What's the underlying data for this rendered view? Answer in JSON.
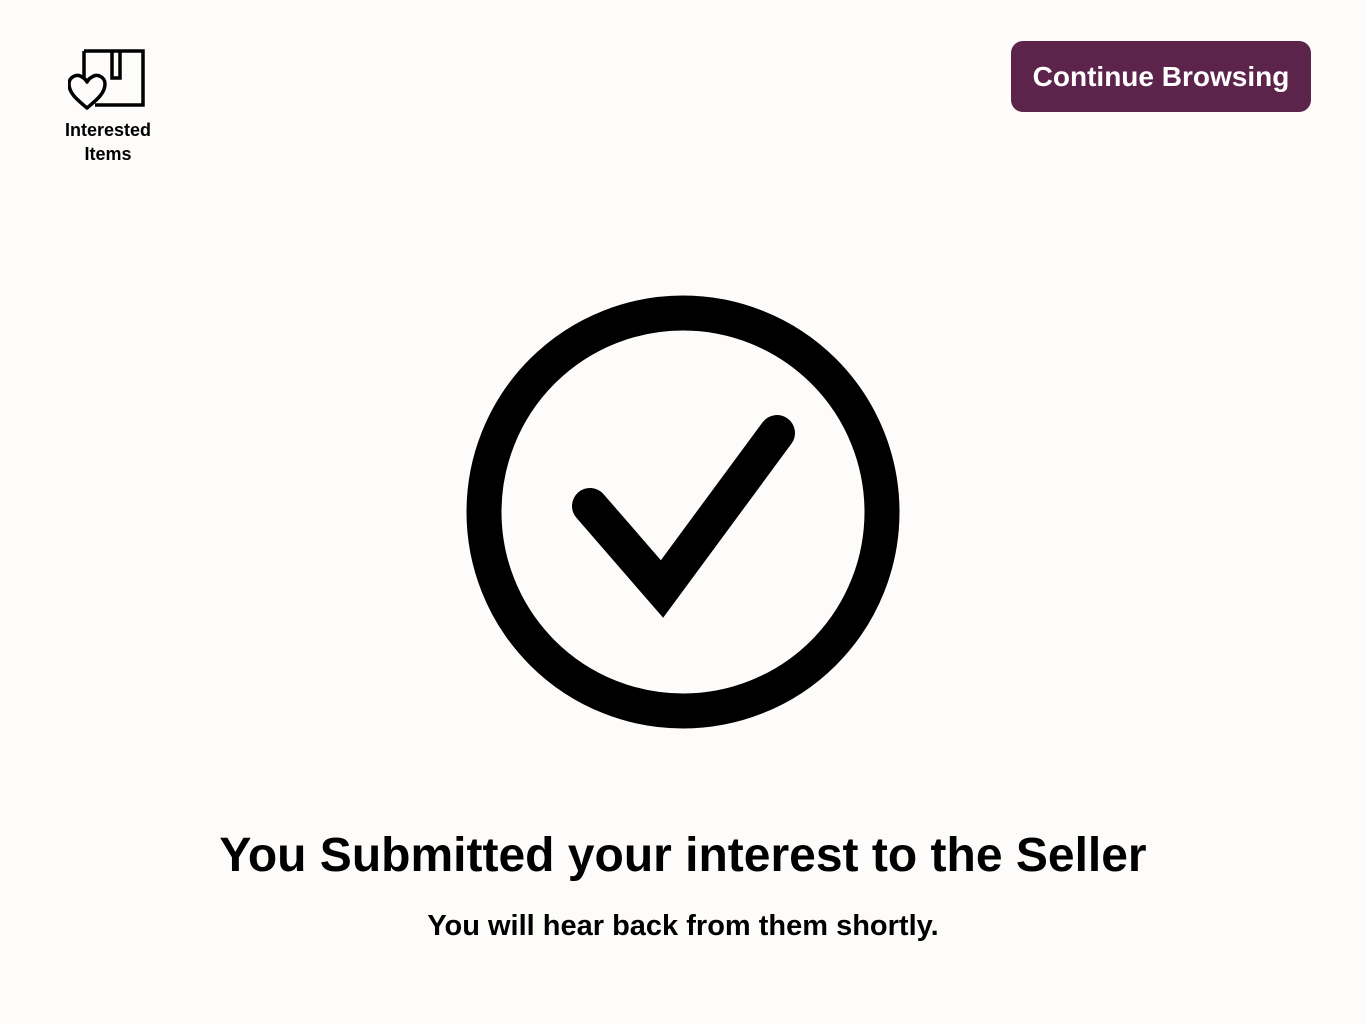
{
  "header": {
    "interested_items": {
      "label": "Interested\nItems",
      "icon": "box-heart-icon"
    },
    "continue_button": {
      "label": "Continue Browsing",
      "color": "#5c244b"
    }
  },
  "confirmation": {
    "icon": "check-circle-icon",
    "title": "You Submitted your interest to the Seller",
    "subtitle": "You will hear back from them shortly."
  },
  "colors": {
    "background": "#fdfcfa",
    "text": "#000000",
    "accent": "#5c244b"
  }
}
